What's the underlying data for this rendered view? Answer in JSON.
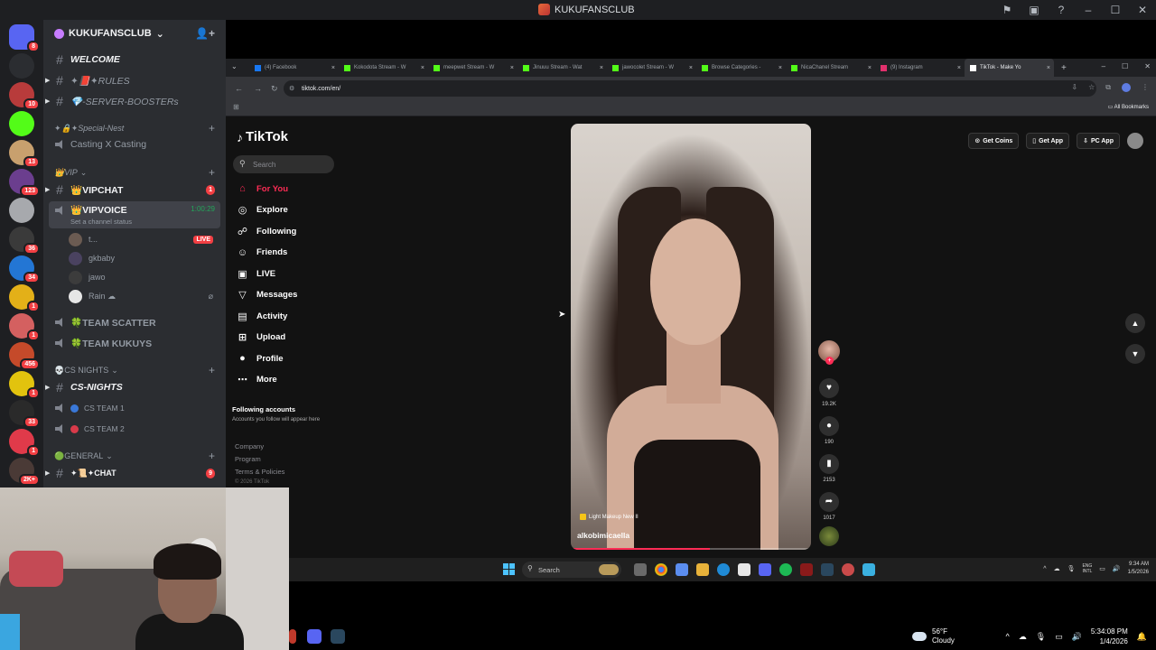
{
  "discord": {
    "window_title": "KUKUFANSCLUB",
    "server_name": "KUKUFANSCLUB",
    "rail": [
      {
        "icon": "discord-home-icon",
        "color": "#5865f2",
        "badge": "8"
      },
      {
        "icon": "info-icon",
        "color": "#2b2d31",
        "badge": ""
      },
      {
        "icon": "server-icon",
        "color": "#b83b3b",
        "badge": "10"
      },
      {
        "icon": "kick-icon",
        "color": "#53fc18",
        "badge": ""
      },
      {
        "icon": "server-icon",
        "color": "#c8a06e",
        "badge": "13"
      },
      {
        "icon": "server-icon",
        "color": "#6b3e8e",
        "badge": "123"
      },
      {
        "icon": "server-icon",
        "color": "#a7a9ad",
        "badge": ""
      },
      {
        "icon": "server-icon",
        "color": "#3a3a3a",
        "badge": "36"
      },
      {
        "icon": "server-icon",
        "color": "#2376d4",
        "badge": "34"
      },
      {
        "icon": "server-icon",
        "color": "#e3b018",
        "badge": "1"
      },
      {
        "icon": "server-icon",
        "color": "#d46060",
        "badge": "1"
      },
      {
        "icon": "server-icon",
        "color": "#c54a2a",
        "badge": "456"
      },
      {
        "icon": "server-icon",
        "color": "#e2c30e",
        "badge": "1"
      },
      {
        "icon": "server-icon",
        "color": "#2a2a2a",
        "badge": "33"
      },
      {
        "icon": "server-icon",
        "color": "#e03a4a",
        "badge": "1"
      },
      {
        "icon": "server-icon",
        "color": "#4a3a36",
        "badge": "2K+"
      }
    ],
    "channels": {
      "welcome": "WELCOME",
      "rules": "✦📕✦RULES",
      "boosters": "💎-SERVER-BOOSTERs",
      "cat_special": "✦🔒✦Special-Nest",
      "casting": "Casting X Casting",
      "cat_vip": "👑VIP",
      "vipchat": "👑VIPCHAT",
      "vipchat_count": "1",
      "vipvoice": "👑VIPVOICE",
      "vipvoice_status": "Set a channel status",
      "vipvoice_timer": "1:00:29",
      "voice_users": [
        {
          "name": "t...",
          "live": "LIVE"
        },
        {
          "name": "gkbaby",
          "live": ""
        },
        {
          "name": "jawo",
          "live": ""
        },
        {
          "name": "Rain ☁",
          "live": ""
        }
      ],
      "team_scatter": "🍀TEAM SCATTER",
      "team_kukuys": "🍀TEAM KUKUYS",
      "cat_csnights": "💀CS NIGHTS",
      "cs_nights": "CS-NIGHTS",
      "cs_team1": "CS TEAM 1",
      "cs_team2": "CS TEAM 2",
      "cat_general": "🟢GENERAL",
      "chat": "✦📜✦CHAT",
      "chat_count": "9"
    }
  },
  "browser": {
    "tabs": [
      {
        "label": "(4) Facebook",
        "fav": "#1877f2",
        "active": false
      },
      {
        "label": "Kokodota Stream - W",
        "fav": "#53fc18",
        "active": false
      },
      {
        "label": "meepwet Stream - W",
        "fav": "#53fc18",
        "active": false
      },
      {
        "label": "Jinuuu Stream - Wat",
        "fav": "#53fc18",
        "active": false
      },
      {
        "label": "jawocolet Stream - W",
        "fav": "#53fc18",
        "active": false
      },
      {
        "label": "Browse Categories -",
        "fav": "#53fc18",
        "active": false
      },
      {
        "label": "NicaChanel Stream",
        "fav": "#53fc18",
        "active": false
      },
      {
        "label": "(9) Instagram",
        "fav": "#e1306c",
        "active": false
      },
      {
        "label": "TikTok - Make Yo",
        "fav": "#ffffff",
        "active": true
      }
    ],
    "url": "tiktok.com/en/",
    "all_bookmarks": "All Bookmarks"
  },
  "tiktok": {
    "logo": "TikTok",
    "search_placeholder": "Search",
    "nav": [
      {
        "label": "For You",
        "icon": "home-icon",
        "glyph": "⌂",
        "active": true
      },
      {
        "label": "Explore",
        "icon": "compass-icon",
        "glyph": "◎",
        "active": false
      },
      {
        "label": "Following",
        "icon": "following-icon",
        "glyph": "☍",
        "active": false
      },
      {
        "label": "Friends",
        "icon": "friends-icon",
        "glyph": "☺",
        "active": false
      },
      {
        "label": "LIVE",
        "icon": "live-icon",
        "glyph": "▣",
        "active": false
      },
      {
        "label": "Messages",
        "icon": "messages-icon",
        "glyph": "▽",
        "active": false
      },
      {
        "label": "Activity",
        "icon": "activity-icon",
        "glyph": "▤",
        "active": false
      },
      {
        "label": "Upload",
        "icon": "upload-icon",
        "glyph": "⊞",
        "active": false
      },
      {
        "label": "Profile",
        "icon": "profile-icon",
        "glyph": "●",
        "active": false
      },
      {
        "label": "More",
        "icon": "more-icon",
        "glyph": "⋯",
        "active": false
      }
    ],
    "following_title": "Following accounts",
    "following_sub": "Accounts you follow will appear here",
    "footer": [
      "Company",
      "Program",
      "Terms & Policies"
    ],
    "copyright": "© 2026 TikTok",
    "top_buttons": [
      "Get Coins",
      "Get App",
      "PC App"
    ],
    "video": {
      "tag": "Light Makeup New II",
      "author": "alkobimicaella",
      "progress": 0.58
    },
    "actions": {
      "likes": "19.2K",
      "comments": "190",
      "saves": "2153",
      "shares": "1017"
    }
  },
  "inner_taskbar": {
    "search": "Search",
    "lang": "ENG\nINTL",
    "time": "9:34 AM",
    "date": "1/5/2026"
  },
  "outer_taskbar": {
    "temp": "56°F",
    "condition": "Cloudy",
    "time": "5:34:08 PM",
    "date": "1/4/2026"
  }
}
